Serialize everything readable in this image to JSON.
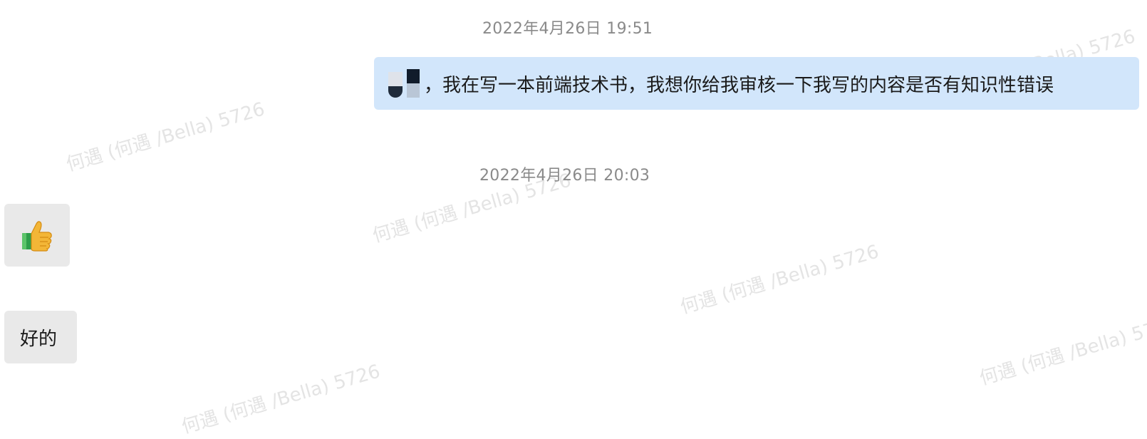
{
  "messages": [
    {
      "timestamp": "2022年4月26日 19:51"
    },
    {
      "text": "，我在写一本前端技术书，我想你给我审核一下我写的内容是否有知识性错误"
    },
    {
      "timestamp": "2022年4月26日 20:03"
    },
    {
      "emoji": "👍"
    },
    {
      "text": "好的"
    }
  ],
  "watermark": "何遇 (何遇 /Bella) 5726",
  "colors": {
    "outgoing_bubble": "#d2e6fb",
    "incoming_bubble": "#e9e9e9",
    "timestamp": "#8a8a8a"
  }
}
